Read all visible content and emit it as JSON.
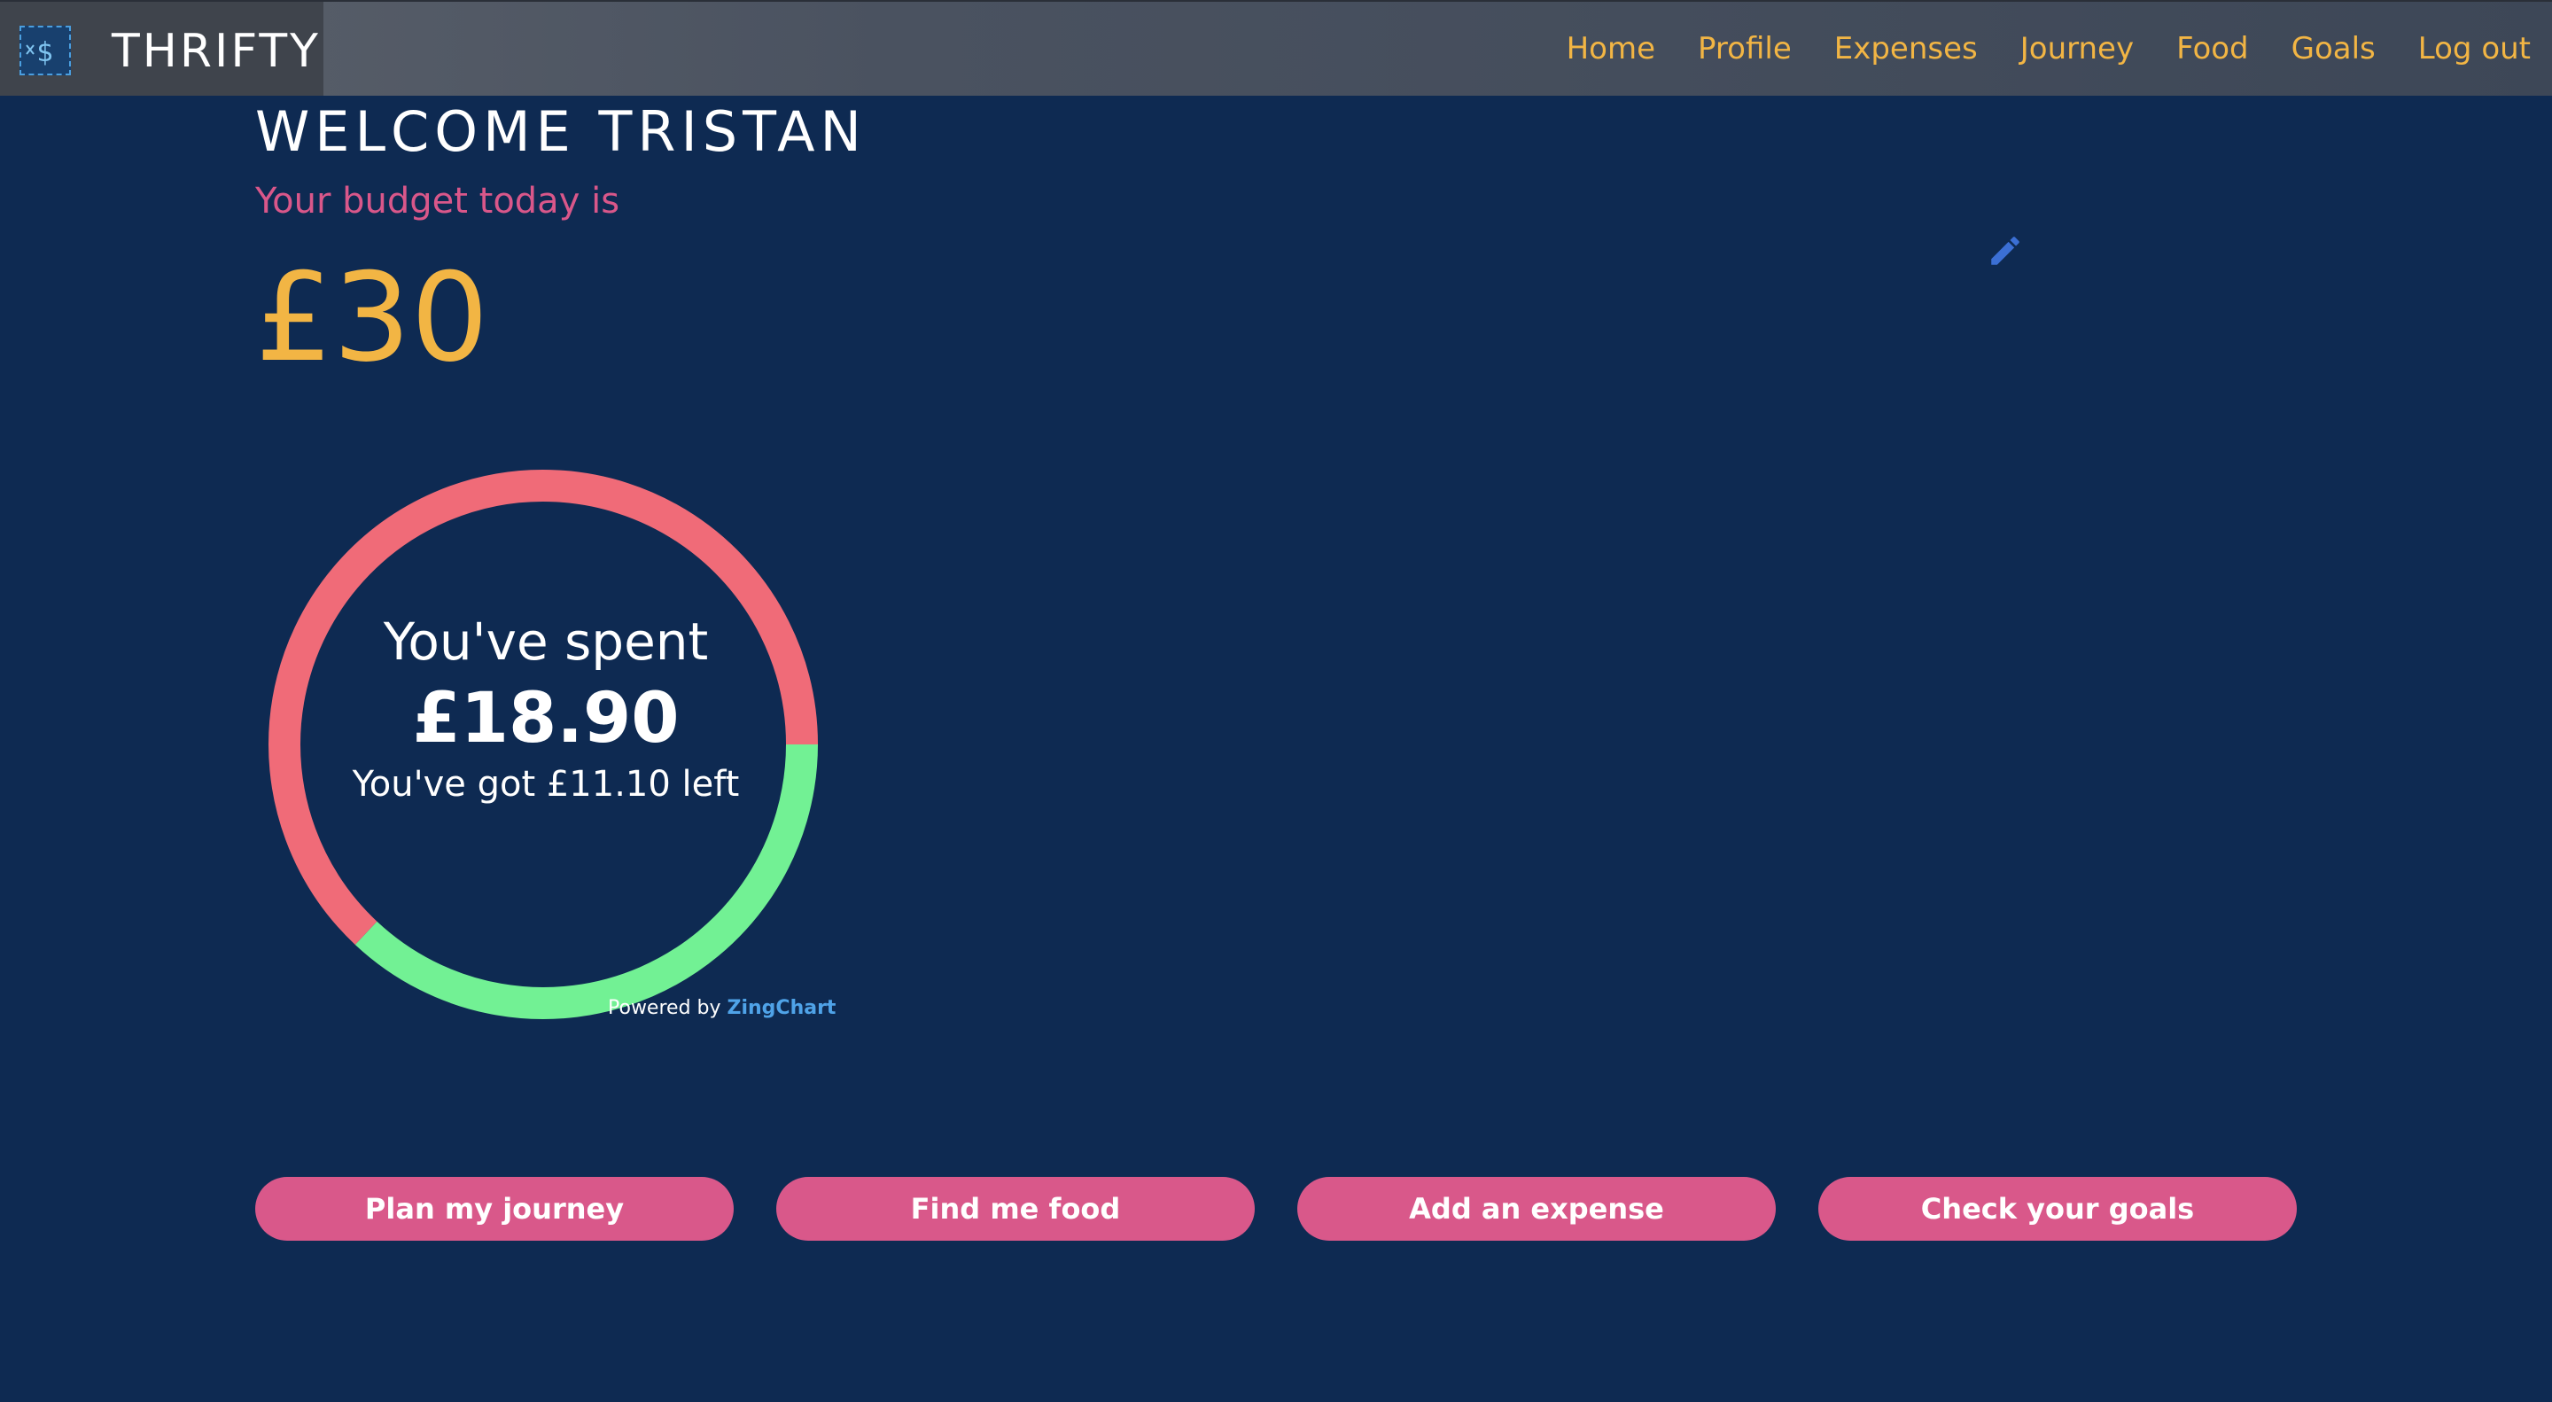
{
  "app": {
    "brand": "THRIFTY",
    "logo_symbol": "$"
  },
  "nav": {
    "items": [
      {
        "label": "Home"
      },
      {
        "label": "Profile"
      },
      {
        "label": "Expenses"
      },
      {
        "label": "Journey"
      },
      {
        "label": "Food"
      },
      {
        "label": "Goals"
      },
      {
        "label": "Log out"
      }
    ]
  },
  "main": {
    "welcome": "WELCOME TRISTAN",
    "budget_label": "Your budget today is",
    "budget_amount": "£30",
    "edit_icon": "pencil-icon"
  },
  "chart": {
    "center_title": "You've spent",
    "center_value": "£18.90",
    "center_subtitle": "You've got £11.10 left",
    "powered_prefix": "Powered by ",
    "powered_brand": "ZingChart"
  },
  "chart_data": {
    "type": "pie",
    "series": [
      {
        "name": "Spent",
        "value": 18.9,
        "color": "#f06b78"
      },
      {
        "name": "Left",
        "value": 11.1,
        "color": "#72f194"
      }
    ],
    "total": 30
  },
  "actions": [
    {
      "label": "Plan my journey"
    },
    {
      "label": "Find me food"
    },
    {
      "label": "Add an expense"
    },
    {
      "label": "Check your goals"
    }
  ],
  "colors": {
    "background": "#0e2a52",
    "accent": "#f2b544",
    "pink": "#d9588a",
    "spent": "#f06b78",
    "left": "#72f194"
  }
}
